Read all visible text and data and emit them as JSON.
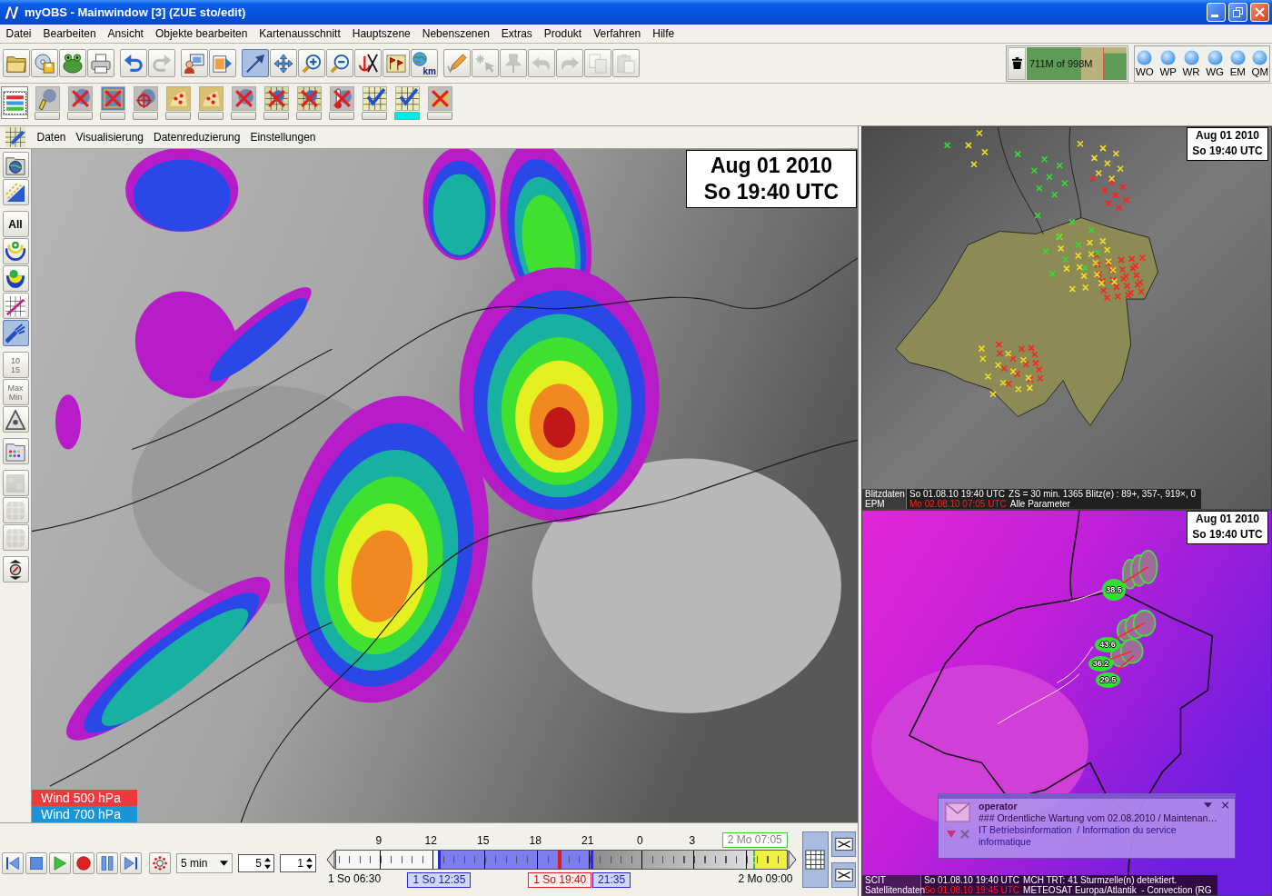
{
  "window": {
    "title": "myOBS - Mainwindow [3] (ZUE sto/edit)"
  },
  "menu": [
    "Datei",
    "Bearbeiten",
    "Ansicht",
    "Objekte bearbeiten",
    "Kartenausschnitt",
    "Hauptszene",
    "Nebenszenen",
    "Extras",
    "Produkt",
    "Verfahren",
    "Hilfe"
  ],
  "toolbar": {
    "groups": [
      [
        {
          "kind": "icon",
          "selected": false,
          "disabled": false
        },
        {
          "kind": "icon",
          "selected": false,
          "disabled": false
        },
        {
          "kind": "icon",
          "selected": false,
          "disabled": false
        },
        {
          "kind": "icon",
          "selected": false,
          "disabled": false
        }
      ],
      [
        {
          "kind": "icon",
          "selected": false,
          "disabled": false
        },
        {
          "kind": "icon",
          "selected": false,
          "disabled": true
        }
      ],
      [
        {
          "kind": "icon",
          "selected": false,
          "disabled": false
        },
        {
          "kind": "icon",
          "selected": false,
          "disabled": false
        }
      ],
      [
        {
          "kind": "icon",
          "selected": true,
          "disabled": false
        },
        {
          "kind": "icon",
          "selected": false,
          "disabled": false
        },
        {
          "kind": "icon",
          "selected": false,
          "disabled": false
        },
        {
          "kind": "icon",
          "selected": false,
          "disabled": false
        },
        {
          "kind": "icon",
          "selected": false,
          "disabled": false
        },
        {
          "kind": "icon",
          "selected": false,
          "disabled": false
        },
        {
          "kind": "icon_label",
          "label": "km",
          "selected": false,
          "disabled": false
        }
      ],
      [
        {
          "kind": "icon",
          "selected": false,
          "disabled": false
        },
        {
          "kind": "icon",
          "selected": false,
          "disabled": true
        },
        {
          "kind": "icon",
          "selected": false,
          "disabled": true
        },
        {
          "kind": "icon",
          "selected": false,
          "disabled": true
        },
        {
          "kind": "icon",
          "selected": false,
          "disabled": true
        },
        {
          "kind": "icon",
          "selected": false,
          "disabled": true
        },
        {
          "kind": "icon",
          "selected": false,
          "disabled": true
        }
      ]
    ]
  },
  "memory": {
    "label": "711M of 998M",
    "level": 0.71
  },
  "status_lights": [
    {
      "label": "WO"
    },
    {
      "label": "WP"
    },
    {
      "label": "WR"
    },
    {
      "label": "WG"
    },
    {
      "label": "EM"
    },
    {
      "label": "QM"
    }
  ],
  "layer_toolbar": [
    {
      "kind": "list",
      "on": false
    },
    {
      "kind": "toggle",
      "on": false
    },
    {
      "kind": "toggle",
      "on": false
    },
    {
      "kind": "toggle",
      "on": false
    },
    {
      "kind": "toggle",
      "on": false
    },
    {
      "kind": "toggle",
      "on": false
    },
    {
      "kind": "toggle",
      "on": false
    },
    {
      "kind": "toggle",
      "on": false
    },
    {
      "kind": "toggle",
      "on": false
    },
    {
      "kind": "toggle",
      "on": false
    },
    {
      "kind": "toggle",
      "on": false
    },
    {
      "kind": "toggle",
      "on": false
    },
    {
      "kind": "toggle",
      "on": true
    },
    {
      "kind": "toggle",
      "on": false
    }
  ],
  "scene": {
    "menu": [
      "Daten",
      "Visualisierung",
      "Datenreduzierung",
      "Einstellungen"
    ],
    "tools": [
      [
        {
          "kind": "icon",
          "selected": false,
          "disabled": false
        },
        {
          "kind": "icon",
          "selected": false,
          "disabled": false
        }
      ],
      [
        {
          "kind": "text",
          "label": "All",
          "selected": false,
          "disabled": false
        },
        {
          "kind": "icon",
          "selected": false,
          "disabled": false
        },
        {
          "kind": "icon",
          "selected": false,
          "disabled": false
        },
        {
          "kind": "icon",
          "selected": false,
          "disabled": false
        },
        {
          "kind": "icon",
          "selected": true,
          "disabled": false
        }
      ],
      [
        {
          "kind": "text",
          "label": "10 15",
          "selected": false,
          "disabled": true
        },
        {
          "kind": "text",
          "label": "Max Min",
          "selected": false,
          "disabled": true
        },
        {
          "kind": "icon",
          "selected": false,
          "disabled": false
        }
      ],
      [
        {
          "kind": "icon",
          "selected": false,
          "disabled": false
        }
      ],
      [
        {
          "kind": "icon",
          "selected": false,
          "disabled": true
        },
        {
          "kind": "icon",
          "selected": false,
          "disabled": true
        },
        {
          "kind": "icon",
          "selected": false,
          "disabled": true
        }
      ],
      [
        {
          "kind": "icon",
          "selected": false,
          "disabled": false
        }
      ]
    ],
    "date": {
      "day": "Aug 01 2010",
      "time": "So 19:40 UTC"
    },
    "legend": [
      {
        "label": "Wind 500 hPa",
        "color": "#f03a3a"
      },
      {
        "label": "Wind 700 hPa",
        "color": "#1a96d8"
      }
    ]
  },
  "player": {
    "interval": "5 min",
    "step": "5",
    "speed": "1"
  },
  "timeline": {
    "hours": [
      "9",
      "12",
      "15",
      "18",
      "21",
      "0",
      "3"
    ],
    "start": "1 So 06:30",
    "end": "2 Mo 09:00",
    "selection_start": {
      "label": "1 So 12:35",
      "level": 0.23
    },
    "selection_end": {
      "label": "21:35",
      "level": 0.569
    },
    "current": {
      "label": "1 So 19:40",
      "level": 0.497
    },
    "forecast": {
      "label": "2 Mo 07:05",
      "level": 0.928
    }
  },
  "lightning_panel": {
    "date": {
      "day": "Aug 01 2010",
      "time": "So 19:40 UTC"
    },
    "info": [
      {
        "name": "Blitzdaten",
        "time": "So 01.08.10 19:40 UTC",
        "text": "ZS = 30 min. 1365 Blitz(e) : 89+, 357-, 919×, 0",
        "stale": false
      },
      {
        "name": "EPM",
        "time": "Mo 02.08.10 07:05 UTC",
        "text": "Alle Parameter",
        "stale": true
      }
    ]
  },
  "satellite_panel": {
    "date": {
      "day": "Aug 01 2010",
      "time": "So 19:40 UTC"
    },
    "storm_cells": [
      {
        "label": "38.5"
      },
      {
        "label": "43.6"
      },
      {
        "label": "36.2"
      },
      {
        "label": "29.5"
      }
    ],
    "notification": {
      "sender": "operator",
      "message": "### Ordentliche Wartung vom 02.08.2010 / Maintenan…",
      "category": "IT Betriebsinformation  / Information du service informatique"
    },
    "info": [
      {
        "name": "SCIT",
        "time": "So 01.08.10 19:40 UTC",
        "text": "MCH TRT: 41 Sturmzelle(n) detektiert.",
        "stale": false
      },
      {
        "name": "Satellitendaten",
        "time": "So 01.08.10 19:45 UTC",
        "text": "METEOSAT Europa/Atlantik  - Convection (RG",
        "stale": true
      }
    ]
  }
}
